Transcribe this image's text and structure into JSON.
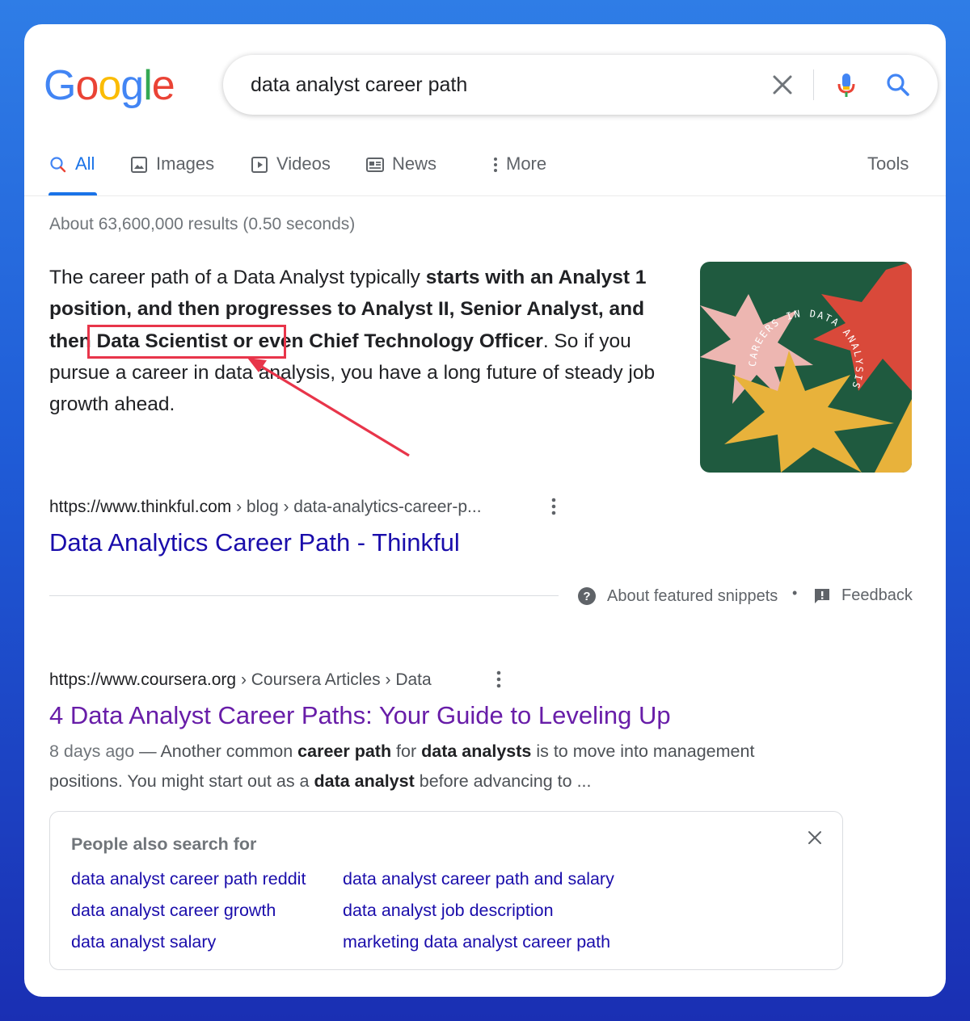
{
  "search": {
    "query": "data analyst career path"
  },
  "logo": {
    "letters": [
      "G",
      "o",
      "o",
      "g",
      "l",
      "e"
    ]
  },
  "tabs": [
    {
      "label": "All",
      "icon": "search-icon",
      "active": true
    },
    {
      "label": "Images",
      "icon": "image-icon"
    },
    {
      "label": "Videos",
      "icon": "video-icon"
    },
    {
      "label": "News",
      "icon": "news-icon"
    },
    {
      "label": "More",
      "icon": "more-vertical-icon"
    }
  ],
  "tools_label": "Tools",
  "result_stats": "About 63,600,000 results (0.50 seconds)",
  "featured_snippet": {
    "text_parts": [
      {
        "text": "The career path of a Data Analyst typically ",
        "bold": false
      },
      {
        "text": "starts with an Analyst 1 position, and then progresses to Analyst II, Senior Analyst, and then Data Scientist or even Chief Technology Officer",
        "bold": true
      },
      {
        "text": ". So if you pursue a career in data analysis, you have a long future of steady job growth ahead.",
        "bold": false
      }
    ],
    "image_text": "CAREERS IN DATA ANALYSIS",
    "url_host": "https://www.thinkful.com",
    "url_crumbs": "› blog › data-analytics-career-p...",
    "title": "Data Analytics Career Path - Thinkful",
    "about_label": "About featured snippets",
    "separator": "•",
    "feedback_label": "Feedback"
  },
  "results": [
    {
      "url_host": "https://www.coursera.org",
      "url_crumbs": "› Coursera Articles › Data",
      "title": "4 Data Analyst Career Paths: Your Guide to Leveling Up",
      "date": "8 days ago",
      "desc_parts": [
        {
          "text": " — Another common ",
          "bold": false
        },
        {
          "text": "career path",
          "bold": true
        },
        {
          "text": " for ",
          "bold": false
        },
        {
          "text": "data analysts",
          "bold": true
        },
        {
          "text": " is to move into management positions. You might start out as a ",
          "bold": false
        },
        {
          "text": "data analyst",
          "bold": true
        },
        {
          "text": " before advancing to ...",
          "bold": false
        }
      ]
    }
  ],
  "people_also_search": {
    "title": "People also search for",
    "links": [
      "data analyst career path reddit",
      "data analyst career path and salary",
      "data analyst career growth",
      "data analyst job description",
      "data analyst salary",
      "marketing data analyst career path"
    ]
  },
  "colors": {
    "link": "#1a0dab",
    "visited": "#681da8",
    "accent": "#1a73e8",
    "annotation": "#e8354a"
  }
}
